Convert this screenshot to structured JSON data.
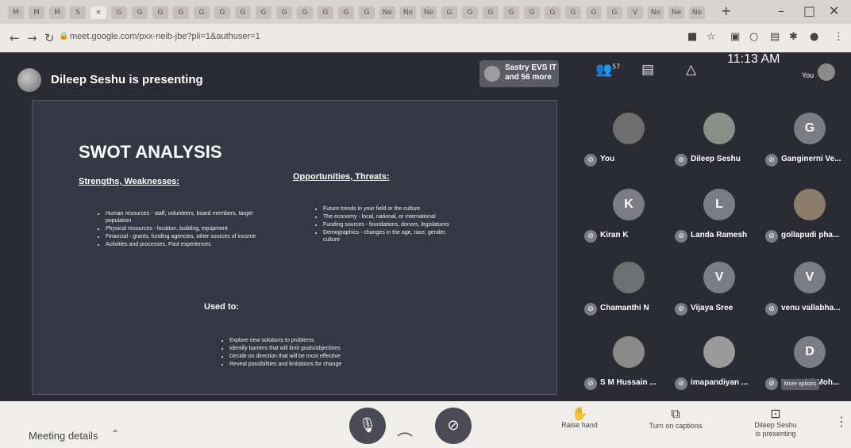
{
  "browser": {
    "url": "meet.google.com/pxx-neib-jbe?pli=1&authuser=1",
    "tab_icons": [
      "M",
      "M",
      "M",
      "S",
      "×",
      "G",
      "G",
      "G",
      "G",
      "G",
      "G",
      "G",
      "G",
      "G",
      "G",
      "G",
      "G",
      "G",
      "Ne",
      "Ne",
      "Ne",
      "G",
      "G",
      "G",
      "G",
      "G",
      "G",
      "G",
      "G",
      "G",
      "V",
      "Ne",
      "Ne",
      "Ne"
    ],
    "new_tab": "+"
  },
  "meet": {
    "presenter_banner": "Dileep Seshu is presenting",
    "participants_summary": {
      "line1": "Sastry EVS IT",
      "line2": "and 56 more"
    },
    "people_count": "57",
    "clock": "11:13 AM",
    "you_label": "You",
    "more_options": "More options"
  },
  "slide": {
    "title": "SWOT ANALYSIS",
    "strengths_heading": "Strengths, Weaknesses:",
    "strengths_items": [
      "Human resources - staff, volunteers, board members, target population",
      "Physical resources - location, building, equipment",
      "Financial - grants, funding agencies, other sources of income",
      "Activities and processes, Past experiences"
    ],
    "opportunities_heading": "Opportunities, Threats:",
    "opportunities_items": [
      "Future trends in your field or the culture",
      "The economy - local, national, or international",
      "Funding sources - foundations, donors, legislatures",
      "Demographics - changes in the age, race, gender, culture"
    ],
    "used_heading": "Used to:",
    "used_items": [
      "Explore new solutions to problems",
      "Identify barriers that will limit goals/objectives",
      "Decide on direction that will be most effective",
      "Reveal possibilities and limitations for change"
    ]
  },
  "tiles": [
    {
      "name": "You",
      "initial": "",
      "color": "#6e6e6e"
    },
    {
      "name": "Dileep Seshu",
      "initial": "",
      "color": "#8a8f8a"
    },
    {
      "name": "Ganginerni Ve...",
      "initial": "G",
      "color": "#7b7c86"
    },
    {
      "name": "Kiran K",
      "initial": "K",
      "color": "#7b7c86"
    },
    {
      "name": "Landa Ramesh",
      "initial": "L",
      "color": "#7b7c86"
    },
    {
      "name": "gollapudi pha...",
      "initial": "",
      "color": "#8a7e6a"
    },
    {
      "name": "Chamanthi N",
      "initial": "",
      "color": "#6d6f70"
    },
    {
      "name": "Vijaya Sree",
      "initial": "V",
      "color": "#7b7c86"
    },
    {
      "name": "venu vallabha...",
      "initial": "V",
      "color": "#7b7c86"
    },
    {
      "name": "S M Hussain ...",
      "initial": "",
      "color": "#8a8a8a"
    },
    {
      "name": "imapandiyan ...",
      "initial": "",
      "color": "#9a9a9a"
    },
    {
      "name": "Dr Reddi Moh...",
      "initial": "D",
      "color": "#7b7c86"
    }
  ],
  "bottom_bar": {
    "meeting_details": "Meeting details",
    "raise_hand": "Raise hand",
    "captions": "Turn on captions",
    "presenting_line1": "Dileep Seshu",
    "presenting_line2": "is presenting"
  }
}
